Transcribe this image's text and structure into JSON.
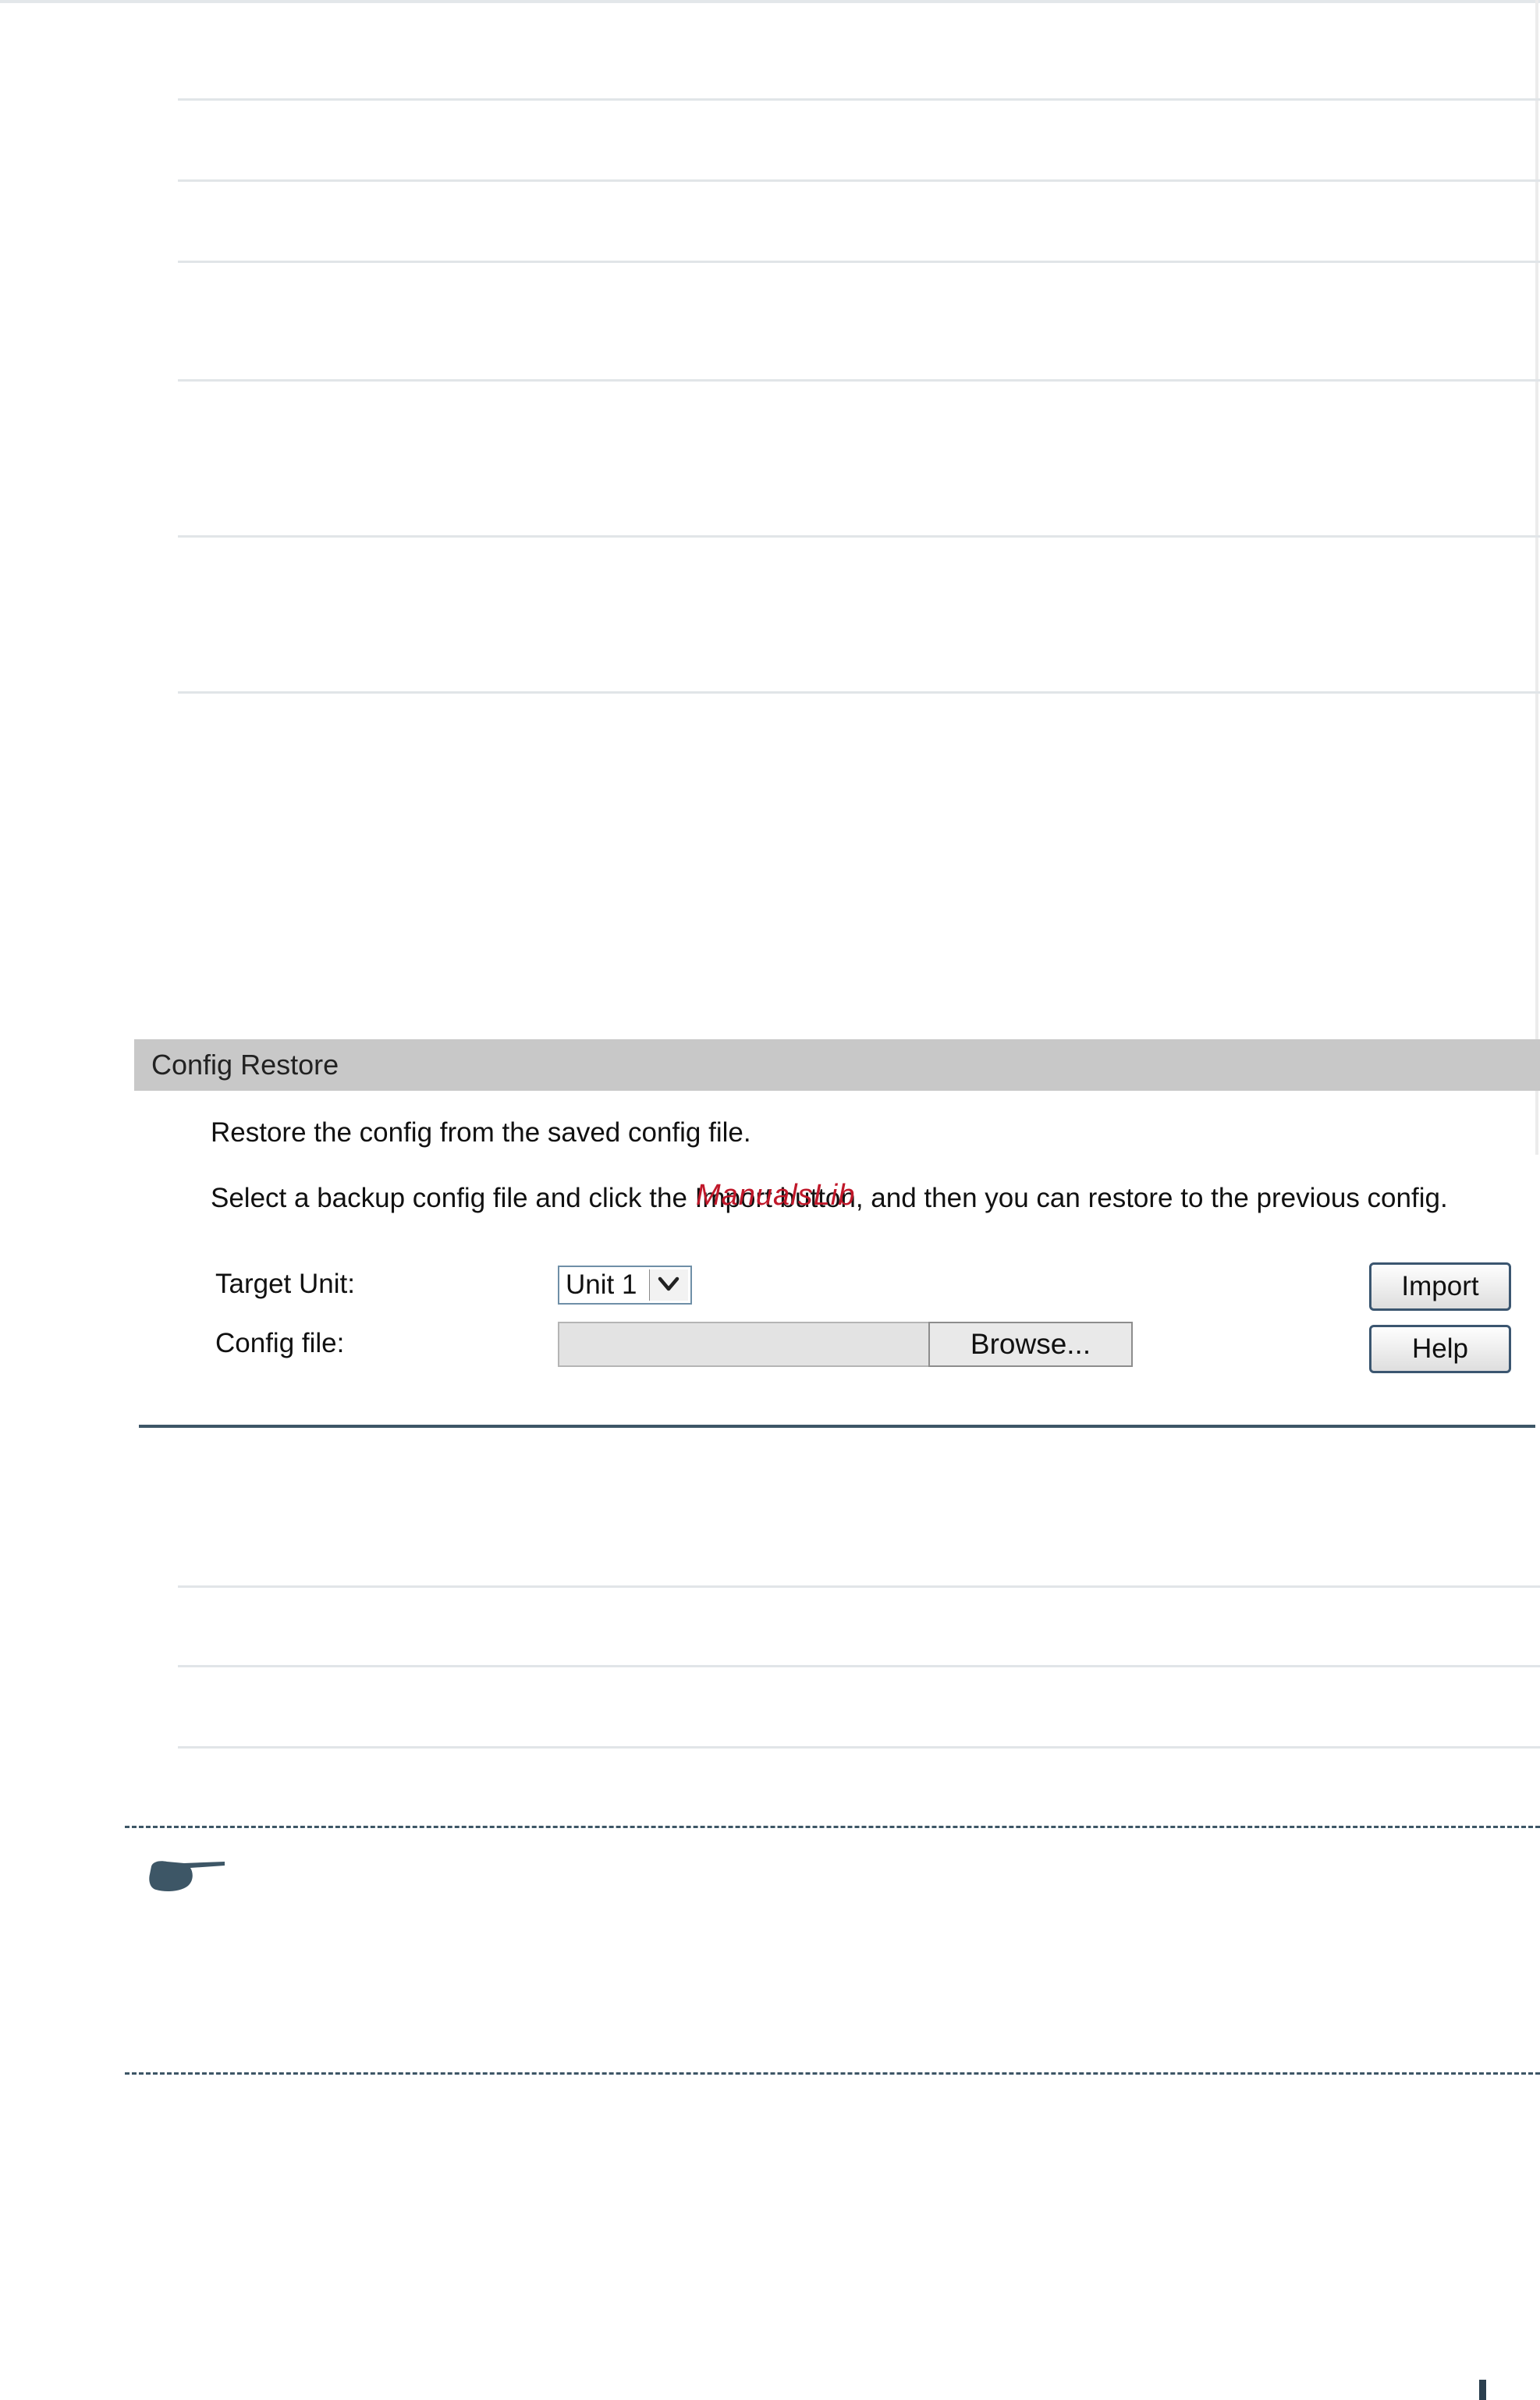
{
  "config_restore": {
    "title": "Config Restore",
    "description": "Restore the config from the saved config file.",
    "instruction": "Select a backup config file and click the Import button, and then you can restore to the previous config.",
    "watermark": "ManualsLib",
    "target_unit_label": "Target Unit:",
    "target_unit_value": "Unit 1",
    "config_file_label": "Config file:",
    "config_file_value": "",
    "browse_label": "Browse...",
    "import_label": "Import",
    "help_label": "Help"
  },
  "icons": {
    "note": "pointing-hand-icon",
    "dropdown": "chevron-down-icon"
  },
  "colors": {
    "header_bg": "#c8c8c8",
    "accent": "#3d5666",
    "watermark": "#c0182a"
  }
}
